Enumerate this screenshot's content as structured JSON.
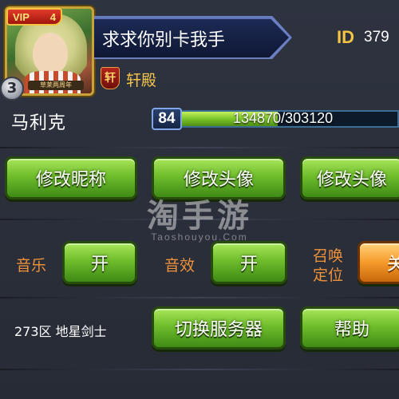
{
  "profile": {
    "vip_label": "VIP",
    "vip_level": "4",
    "rank": "3",
    "avatar_caption": "草莱两周年",
    "nickname": "求求你别卡我手",
    "id_label": "ID",
    "id_value": "379",
    "guild_icon_char": "轩",
    "guild_name": "轩殿",
    "player_name": "马利克",
    "level": "84",
    "xp_text": "134870/303120",
    "xp_current": 134870,
    "xp_max": 303120
  },
  "buttons": {
    "change_nickname": "修改昵称",
    "change_avatar": "修改头像",
    "change_avatar_2": "修改头像",
    "music_toggle": "开",
    "sound_toggle": "开",
    "summon_locate_toggle": "关",
    "switch_server": "切换服务器",
    "help": "帮助"
  },
  "settings": {
    "music_label": "音乐",
    "sound_label": "音效",
    "summon_locate_label_line1": "召唤",
    "summon_locate_label_line2": "定位"
  },
  "server": {
    "info": "273区  地星剑士"
  },
  "watermark": {
    "main": "淘手游",
    "sub": "Taoshouyou.Com"
  },
  "colors": {
    "button_green": "#6fbd2c",
    "button_orange": "#f59a2a",
    "label_orange": "#f0923a",
    "id_gold": "#f5c542",
    "xp_green": "#7cc42a"
  }
}
